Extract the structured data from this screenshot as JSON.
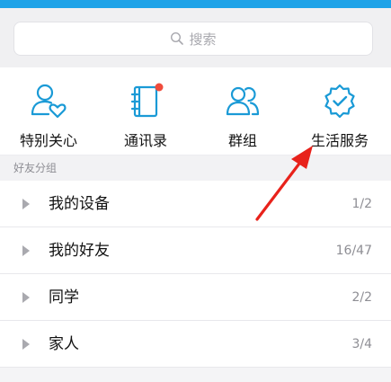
{
  "search": {
    "placeholder": "搜索"
  },
  "quick_actions": [
    {
      "label": "特别关心",
      "icon": "person-heart-icon"
    },
    {
      "label": "通讯录",
      "icon": "address-book-icon",
      "badge": true
    },
    {
      "label": "群组",
      "icon": "group-icon"
    },
    {
      "label": "生活服务",
      "icon": "check-badge-icon"
    }
  ],
  "friends": {
    "section_title": "好友分组",
    "groups": [
      {
        "name": "我的设备",
        "count": "1/2"
      },
      {
        "name": "我的好友",
        "count": "16/47"
      },
      {
        "name": "同学",
        "count": "2/2"
      },
      {
        "name": "家人",
        "count": "3/4"
      }
    ]
  },
  "colors": {
    "accent": "#1fa3e8",
    "icon": "#1a9ad6",
    "badge": "#f04c3c",
    "annotation_arrow": "#e8221b"
  }
}
